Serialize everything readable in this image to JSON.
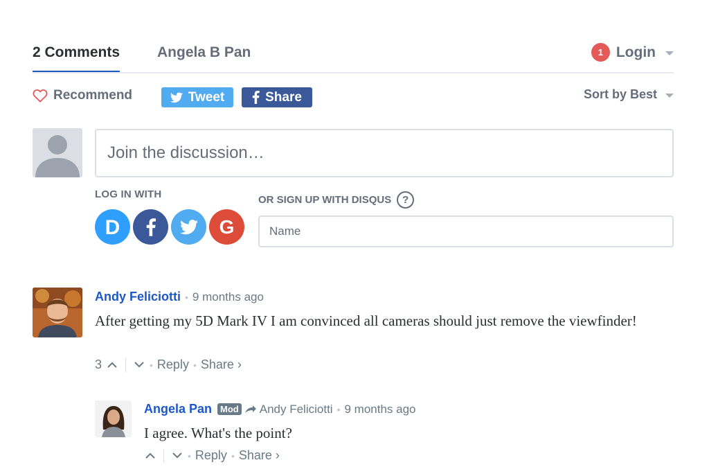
{
  "nav": {
    "comments_tab": "2 Comments",
    "community_tab": "Angela B Pan",
    "notification_count": "1",
    "login_label": "Login"
  },
  "actions": {
    "recommend_label": "Recommend",
    "tweet_label": "Tweet",
    "share_label": "Share",
    "sort_label": "Sort by Best"
  },
  "compose": {
    "placeholder": "Join the discussion…",
    "login_with_label": "LOG IN WITH",
    "signup_label": "OR SIGN UP WITH DISQUS",
    "help_glyph": "?",
    "name_placeholder": "Name",
    "social_icons": [
      "disqus-icon",
      "facebook-icon",
      "twitter-icon",
      "google-icon"
    ]
  },
  "comments": [
    {
      "author": "Andy Feliciotti",
      "time": "9 months ago",
      "text": "After getting my 5D Mark IV I am convinced all cameras should just remove the viewfinder!",
      "upvotes": "3",
      "reply_label": "Reply",
      "share_label": "Share ›"
    },
    {
      "author": "Angela Pan",
      "badge": "Mod",
      "in_reply_to": "Andy Feliciotti",
      "time": "9 months ago",
      "text": "I agree. What's the point?",
      "reply_label": "Reply",
      "share_label": "Share ›"
    }
  ],
  "colors": {
    "link_blue": "#1d58c8",
    "tab_underline": "#1c5bba",
    "badge_red": "#e45a5a",
    "twitter": "#50abf1",
    "facebook": "#3b5998",
    "disqus": "#2e9fff",
    "google": "#dd4b39"
  }
}
